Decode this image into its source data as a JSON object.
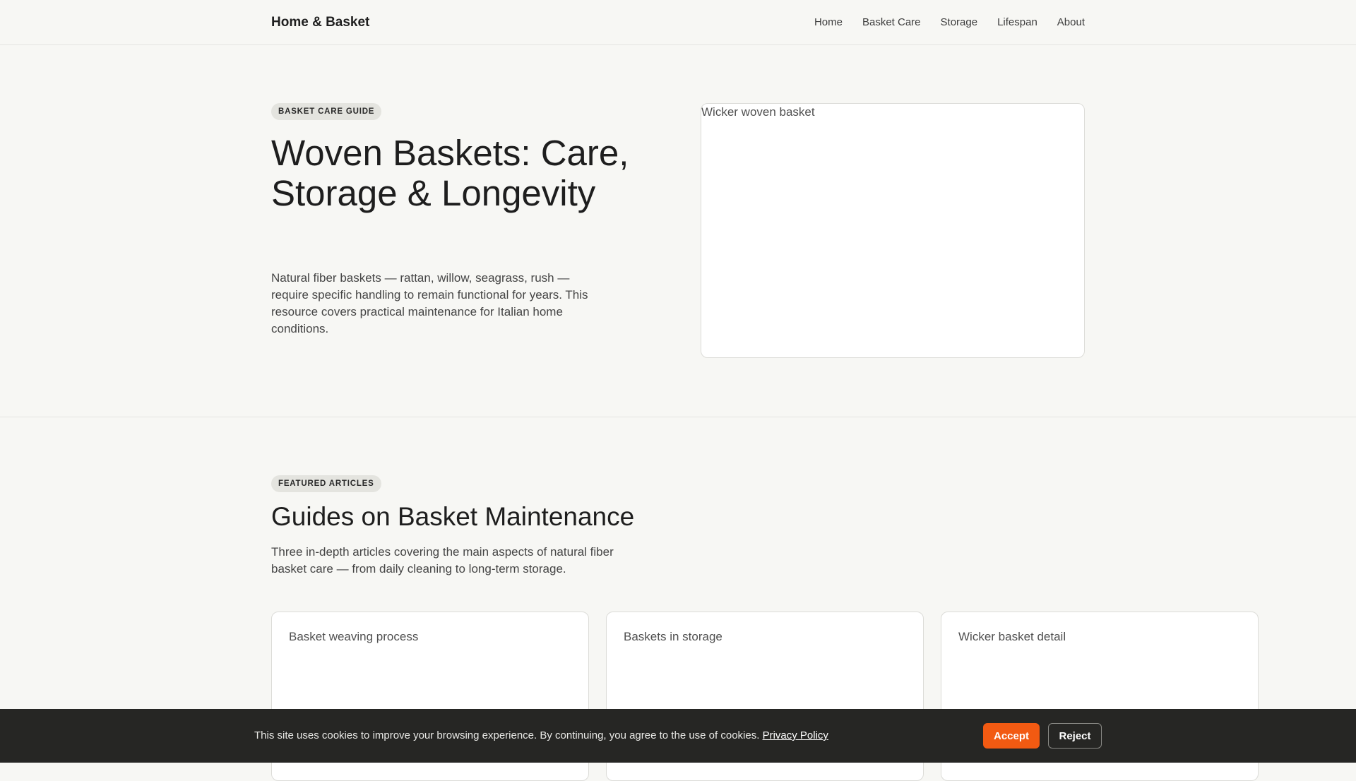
{
  "header": {
    "brand": "Home & Basket",
    "nav": [
      "Home",
      "Basket Care",
      "Storage",
      "Lifespan",
      "About"
    ]
  },
  "hero": {
    "badge": "BASKET CARE GUIDE",
    "title": "Woven Baskets: Care, Storage & Longevity",
    "description": "Natural fiber baskets — rattan, willow, seagrass, rush — require specific handling to remain functional for years. This resource covers practical maintenance for Italian home conditions.",
    "image_alt": "Wicker woven basket"
  },
  "featured": {
    "badge": "FEATURED ARTICLES",
    "title": "Guides on Basket Maintenance",
    "description": "Three in-depth articles covering the main aspects of natural fiber basket care — from daily cleaning to long-term storage.",
    "cards": [
      {
        "image_alt": "Basket weaving process"
      },
      {
        "image_alt": "Baskets in storage"
      },
      {
        "image_alt": "Wicker basket detail"
      }
    ]
  },
  "cookie": {
    "text": "This site uses cookies to improve your browsing experience. By continuing, you agree to the use of cookies.",
    "policy_link": "Privacy Policy",
    "accept_label": "Accept",
    "reject_label": "Reject"
  },
  "colors": {
    "background": "#f7f7f4",
    "accent": "#f25a12",
    "cookie_bar": "#262624"
  }
}
